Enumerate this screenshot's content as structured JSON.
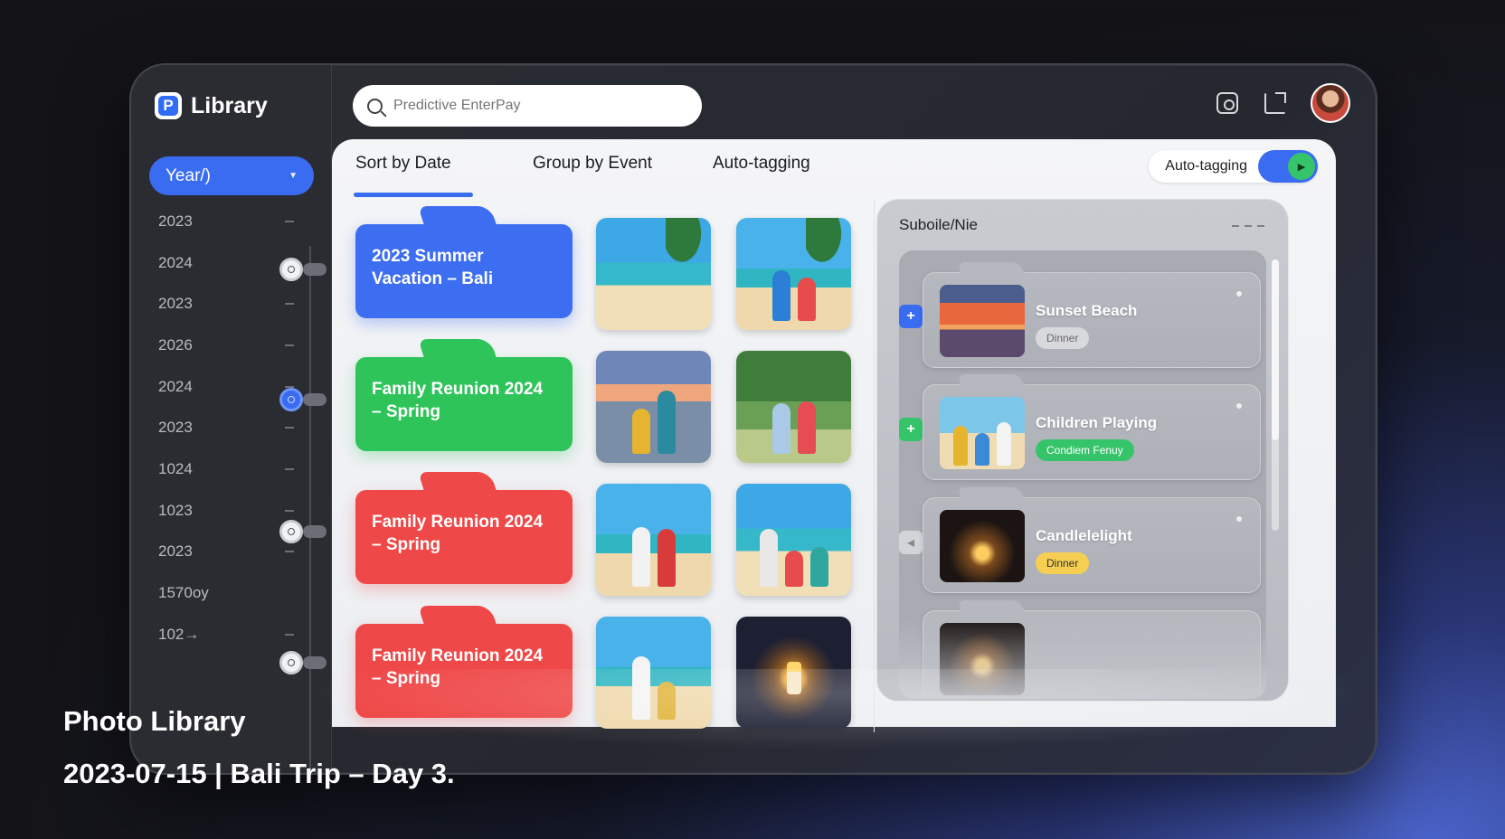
{
  "app": {
    "brand_logo": "P",
    "brand_name": "Library"
  },
  "search": {
    "placeholder": "Predictive EnterPay"
  },
  "sidebar": {
    "year_select_label": "Year/)",
    "years": [
      "2023",
      "2024",
      "2023",
      "2026",
      "2024",
      "2023",
      "1024",
      "1023",
      "2023",
      "1570oy",
      "102→"
    ]
  },
  "tabs": [
    {
      "label": "Sort by Date",
      "active": true
    },
    {
      "label": "Group by Event",
      "active": false
    },
    {
      "label": "Auto-tagging",
      "active": false
    }
  ],
  "auto_tagging": {
    "label": "Auto-tagging",
    "enabled": true
  },
  "folders": [
    {
      "title": "2023 Summer Vacation – Bali",
      "color": "#3d6df0"
    },
    {
      "title": "Family Reunion 2024 – Spring",
      "color": "#2fc45a"
    },
    {
      "title": "Family Reunion 2024 – Spring",
      "color": "#ef4848"
    },
    {
      "title": "Family Reunion 2024 – Spring",
      "color": "#ef4848"
    }
  ],
  "panel": {
    "title": "Suboile/Nie",
    "cards": [
      {
        "title": "Sunset Beach",
        "tag": "Dinner",
        "tag_color": "#d8d9dd",
        "side_icon": "plus-icon",
        "side_color": "#3a6cf2"
      },
      {
        "title": "Children Playing",
        "tag": "Condiem Fenuy",
        "tag_color": "#36c46b",
        "side_icon": "plus-icon",
        "side_color": "#36c46b"
      },
      {
        "title": "Candlelelight",
        "tag": "Dinner",
        "tag_color": "#f6cf52",
        "side_icon": "arrow-icon",
        "side_color": "#d3d4d8"
      }
    ]
  },
  "caption": {
    "line1": "Photo Library",
    "line2": "2023-07-15 | Bali Trip – Day 3."
  }
}
